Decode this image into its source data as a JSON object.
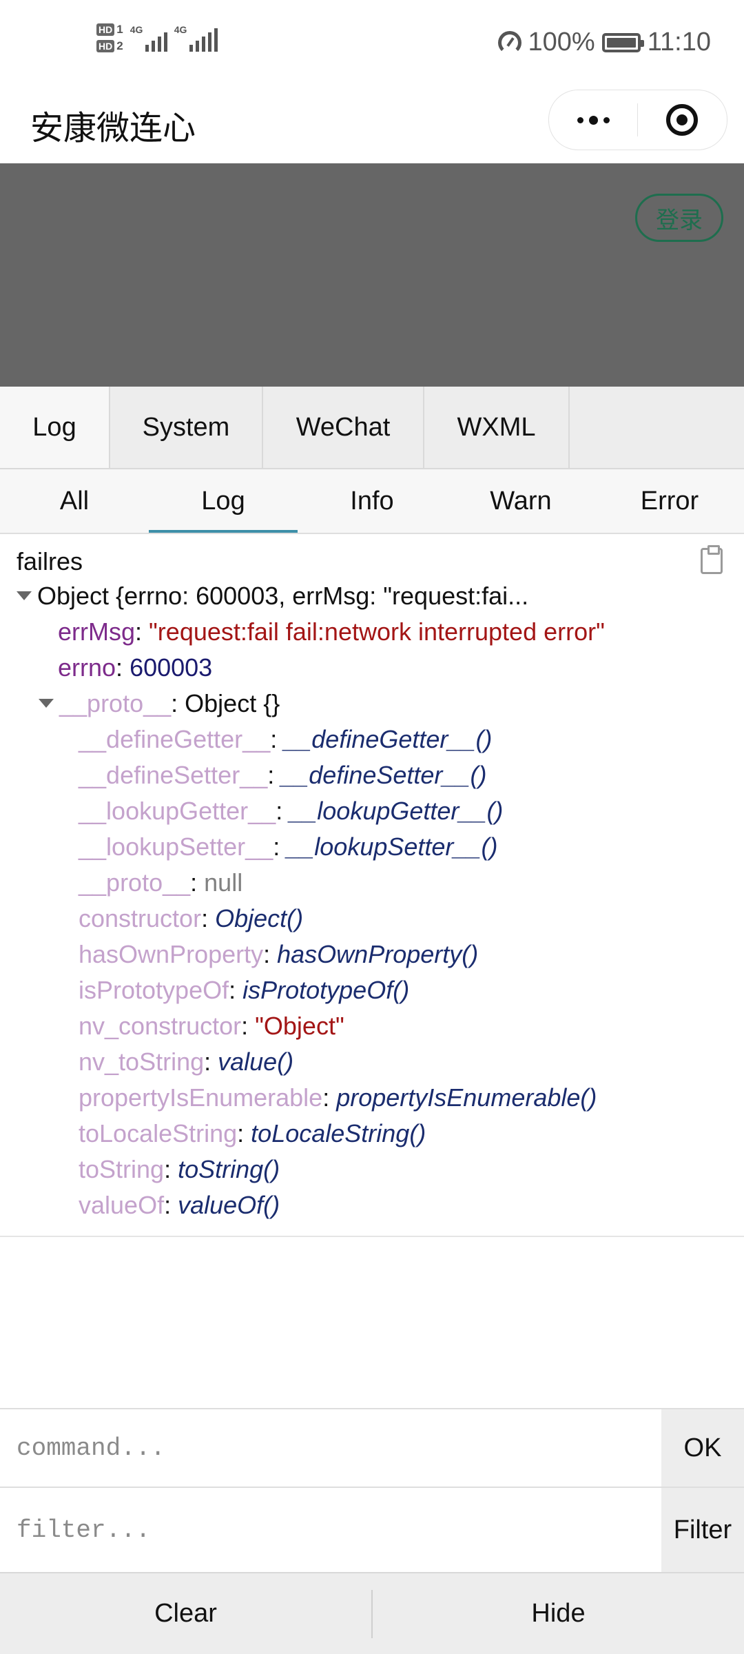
{
  "status_bar": {
    "sim1": "HD",
    "sim1_num": "1",
    "sim2": "HD",
    "sim2_num": "2",
    "net1": "4G",
    "net2": "4G",
    "battery": "100%",
    "time": "11:10"
  },
  "title_bar": {
    "app_title": "安康微连心"
  },
  "page": {
    "login_label": "登录",
    "overlay_color": "#666666"
  },
  "vconsole": {
    "tabs": [
      "Log",
      "System",
      "WeChat",
      "WXML"
    ],
    "active_tab": "Log",
    "log_levels": [
      "All",
      "Log",
      "Info",
      "Warn",
      "Error"
    ],
    "active_level": "Log",
    "log": {
      "label": "failres",
      "summary": "Object {errno: 600003, errMsg: \"request:fai...",
      "props": [
        {
          "key": "errMsg",
          "value": "\"request:fail fail:network interrupted error\""
        },
        {
          "key": "errno",
          "value": "600003"
        }
      ],
      "proto_key": "__proto__",
      "proto_value": ": Object {}",
      "proto_props": [
        {
          "key": "__defineGetter__",
          "value": "__defineGetter__()",
          "type": "fn"
        },
        {
          "key": "__defineSetter__",
          "value": "__defineSetter__()",
          "type": "fn"
        },
        {
          "key": "__lookupGetter__",
          "value": "__lookupGetter__()",
          "type": "fn"
        },
        {
          "key": "__lookupSetter__",
          "value": "__lookupSetter__()",
          "type": "fn"
        },
        {
          "key": "__proto__",
          "value": "null",
          "type": "null"
        },
        {
          "key": "constructor",
          "value": "Object()",
          "type": "fn"
        },
        {
          "key": "hasOwnProperty",
          "value": "hasOwnProperty()",
          "type": "fn"
        },
        {
          "key": "isPrototypeOf",
          "value": "isPrototypeOf()",
          "type": "fn"
        },
        {
          "key": "nv_constructor",
          "value": "\"Object\"",
          "type": "str"
        },
        {
          "key": "nv_toString",
          "value": "value()",
          "type": "fn"
        },
        {
          "key": "propertyIsEnumerable",
          "value": "propertyIsEnumerable()",
          "type": "fn"
        },
        {
          "key": "toLocaleString",
          "value": "toLocaleString()",
          "type": "fn"
        },
        {
          "key": "toString",
          "value": "toString()",
          "type": "fn"
        },
        {
          "key": "valueOf",
          "value": "valueOf()",
          "type": "fn"
        }
      ]
    },
    "command": {
      "placeholder": "command...",
      "button": "OK"
    },
    "filter": {
      "placeholder": "filter...",
      "button": "Filter"
    },
    "footer": {
      "clear": "Clear",
      "hide": "Hide"
    }
  },
  "icons": {
    "signal": "signal-bars-icon",
    "data_saver": "speedometer-icon",
    "battery": "battery-icon",
    "more": "more-dots-icon",
    "close": "target-circle-icon",
    "copy": "clipboard-icon",
    "expand": "triangle-down-icon"
  },
  "colors": {
    "login_accent": "#1e6e4e",
    "active_underline": "#3d8fa8",
    "own_key": "#7d2b8b",
    "proto_key": "#c4a2cc",
    "string_value": "#a31515"
  }
}
